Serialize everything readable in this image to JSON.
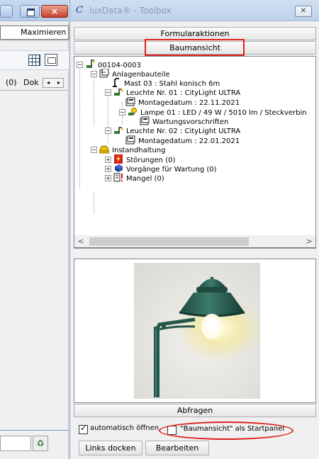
{
  "left_window": {
    "close_glyph": "×",
    "tooltip": "Maximieren",
    "columns": {
      "count": "(0)",
      "doc": "Dok"
    },
    "scroll_left": "◂",
    "scroll_right": "▸",
    "recycle_glyph": "♻"
  },
  "toolbox": {
    "logo": "C",
    "title": "luxData® - Toolbox",
    "close_glyph": "✕",
    "buttons": {
      "formular": "Formularaktionen",
      "baum": "Baumansicht",
      "abfragen": "Abfragen"
    },
    "tree": [
      "00104-0003",
      "Anlagenbauteile",
      "Mast 03 : Stahl konisch 6m",
      "Leuchte Nr. 01 : CityLight ULTRA",
      "Montagedatum : 22.11.2021",
      "Lampe 01 : LED / 49 W / 5010 lm / Steckverbin",
      "Wartungsvorschriften",
      "Leuchte Nr. 02 : CityLight ULTRA",
      "Montagedatum : 22.01.2021",
      "Instandhaltung",
      "Störungen (0)",
      "Vorgänge für Wartung (0)",
      "Mangel (0)"
    ],
    "expander_minus": "−",
    "expander_plus": "+",
    "scroll_left": "<",
    "scroll_right": ">",
    "checkbox_auto": {
      "label": "automatisch öffnen",
      "checked": true
    },
    "checkbox_start": {
      "label": "\"Baumansicht\" als Startpanel",
      "checked": false
    },
    "buttons_bottom": {
      "links": "Links docken",
      "bearb": "Bearbeiten"
    },
    "annotation_color": "#e0201c"
  }
}
